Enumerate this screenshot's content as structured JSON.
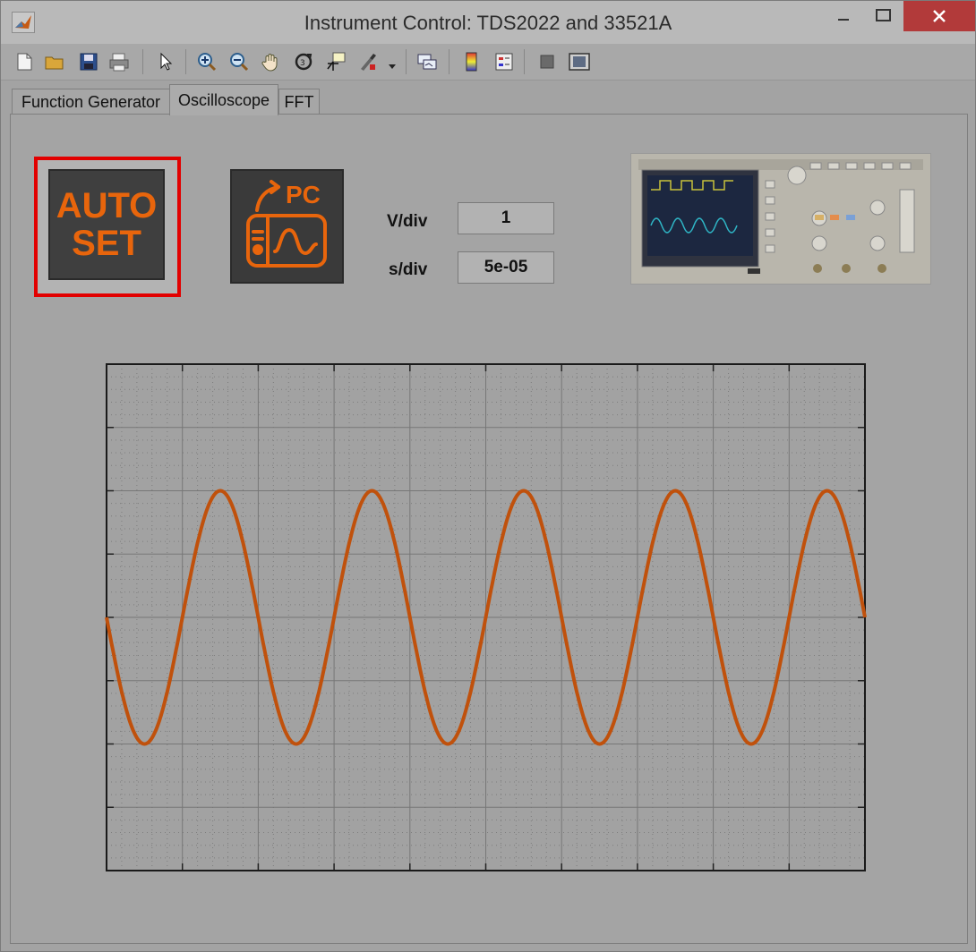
{
  "window": {
    "title": "Instrument Control: TDS2022 and 33521A"
  },
  "toolbar": {
    "items": [
      "new-figure-icon",
      "open-file-icon",
      "save-icon",
      "print-icon",
      "pointer-icon",
      "zoom-in-icon",
      "zoom-out-icon",
      "pan-icon",
      "rotate-3d-icon",
      "data-cursor-icon",
      "brush-icon",
      "link-plot-icon",
      "colorbar-icon",
      "legend-icon",
      "hide-plot-tools-icon",
      "show-plot-tools-icon"
    ]
  },
  "tabs": [
    {
      "label": "Function Generator",
      "active": false
    },
    {
      "label": "Oscilloscope",
      "active": true
    },
    {
      "label": "FFT",
      "active": false
    }
  ],
  "controls": {
    "autoset_line1": "AUTO",
    "autoset_line2": "SET",
    "topc_label": "PC",
    "vdiv_label": "V/div",
    "vdiv_value": "1",
    "sdiv_label": "s/div",
    "sdiv_value": "5e-05"
  },
  "colors": {
    "accent": "#e8650c",
    "trace": "#c0510c",
    "highlight": "#e20000"
  },
  "chart_data": {
    "type": "line",
    "title": "",
    "xlabel": "",
    "ylabel": "",
    "divisions_x": 10,
    "divisions_y": 8,
    "xlim": [
      0,
      10
    ],
    "ylim": [
      -4,
      4
    ],
    "series": [
      {
        "waveform": "sine",
        "amplitude": 2,
        "offset": 0,
        "cycles": 5,
        "phase_start": "falling"
      }
    ]
  }
}
